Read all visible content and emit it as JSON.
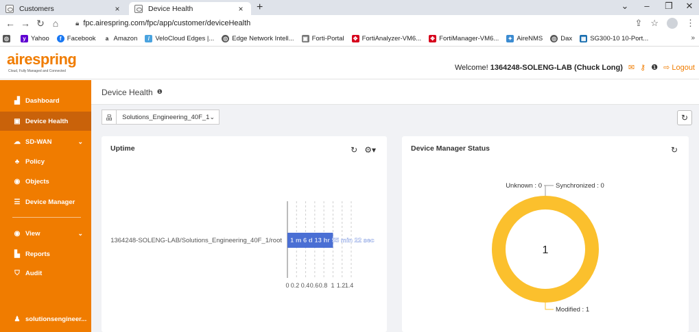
{
  "browser": {
    "tabs": [
      {
        "title": "Customers",
        "active": false
      },
      {
        "title": "Device Health",
        "active": true
      }
    ],
    "new_tab_label": "+",
    "close_label": "×",
    "url": "fpc.airespring.com/fpc/app/customer/deviceHealth",
    "bookmarks": [
      {
        "label": "Yahoo",
        "color": "#5f01d1",
        "glyph": "y"
      },
      {
        "label": "Facebook",
        "color": "#1877f2",
        "glyph": "f"
      },
      {
        "label": "Amazon",
        "color": "#222222",
        "glyph": "a"
      },
      {
        "label": "VeloCloud Edges |...",
        "color": "#4aa3df",
        "glyph": "/"
      },
      {
        "label": "Edge Network Intell...",
        "color": "#555555",
        "glyph": "◎"
      },
      {
        "label": "Forti-Portal",
        "color": "#777777",
        "glyph": "▣"
      },
      {
        "label": "FortiAnalyzer-VM6...",
        "color": "#d6001c",
        "glyph": "✥"
      },
      {
        "label": "FortiManager-VM6...",
        "color": "#d6001c",
        "glyph": "✥"
      },
      {
        "label": "AireNMS",
        "color": "#3b8bd1",
        "glyph": "✦"
      },
      {
        "label": "Dax",
        "color": "#555555",
        "glyph": "◎"
      },
      {
        "label": "SG300-10 10-Port...",
        "color": "#1a6fb0",
        "glyph": "▦"
      }
    ],
    "bookmarks_more": "»"
  },
  "header": {
    "brand": "airespring",
    "brand_tag": "Cloud, Fully Managed and Connected",
    "welcome_prefix": "Welcome! ",
    "welcome_user": "1364248-SOLENG-LAB (Chuck Long)",
    "logout_label": "Logout",
    "accent": "#f07c00"
  },
  "sidebar": {
    "items": [
      {
        "label": "Dashboard",
        "icon": "chart-icon",
        "glyph": "▟"
      },
      {
        "label": "Device Health",
        "icon": "device-icon",
        "glyph": "▣"
      },
      {
        "label": "SD-WAN",
        "icon": "cloud-icon",
        "glyph": "☁"
      },
      {
        "label": "Policy",
        "icon": "users-icon",
        "glyph": "♣"
      },
      {
        "label": "Objects",
        "icon": "objects-icon",
        "glyph": "◉"
      },
      {
        "label": "Device Manager",
        "icon": "list-icon",
        "glyph": "☰"
      },
      {
        "label": "View",
        "icon": "eye-icon",
        "glyph": "◉"
      },
      {
        "label": "Reports",
        "icon": "file-icon",
        "glyph": "▙"
      },
      {
        "label": "Audit",
        "icon": "shield-icon",
        "glyph": "⛉"
      },
      {
        "label": "solutionsengineer...",
        "icon": "user-icon",
        "glyph": "♟"
      }
    ]
  },
  "page": {
    "title": "Device Health",
    "device_selected": "Solutions_Engineering_40F_1"
  },
  "uptime": {
    "title": "Uptime",
    "chart_data": {
      "type": "bar",
      "orientation": "horizontal",
      "categories": [
        "1364248-SOLENG-LAB/Solutions_Engineering_40F_1/root"
      ],
      "values": [
        1
      ],
      "data_labels": [
        "1 m 6 d 13 hr 55 min 22 sec"
      ],
      "x_ticks": [
        "0",
        "0.2",
        "0.4",
        "0.6",
        "0.8",
        "1",
        "1.2",
        "1.4"
      ],
      "xlim": [
        0,
        1.4
      ],
      "bar_color": "#4a6fd4",
      "grid": true
    }
  },
  "dms": {
    "title": "Device Manager Status",
    "chart_data": {
      "type": "pie",
      "donut": true,
      "labels": [
        "Unknown",
        "Synchronized",
        "Modified"
      ],
      "values": [
        0,
        0,
        1
      ],
      "slice_labels": [
        "Unknown : 0",
        "Synchronized : 0",
        "Modified : 1"
      ],
      "colors": [
        "#999999",
        "#999999",
        "#fbc02d"
      ],
      "center_text": "1"
    }
  }
}
